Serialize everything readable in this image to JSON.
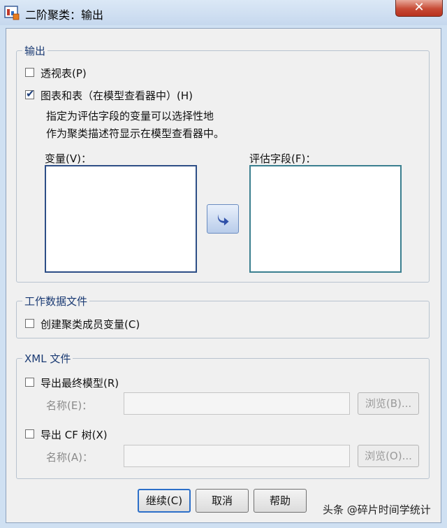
{
  "window": {
    "title": "二阶聚类：输出",
    "close_glyph": "✕"
  },
  "output_group": {
    "legend": "输出",
    "pivot_tables": {
      "label": "透视表(P)",
      "checked": false
    },
    "charts_tables": {
      "label": "图表和表（在模型查看器中）(H)",
      "checked": true
    },
    "description_line1": "指定为评估字段的变量可以选择性地",
    "description_line2": "作为聚类描述符显示在模型查看器中。",
    "variables_label": "变量(V)：",
    "evaluation_fields_label": "评估字段(F)："
  },
  "working_data_group": {
    "legend": "工作数据文件",
    "create_membership": {
      "label": "创建聚类成员变量(C)",
      "checked": false
    }
  },
  "xml_group": {
    "legend": "XML 文件",
    "export_final_model": {
      "label": "导出最终模型(R)",
      "checked": false
    },
    "final_model_name_label": "名称(E)：",
    "final_model_name_value": "",
    "browse1_label": "浏览(B)...",
    "export_cf_tree": {
      "label": "导出 CF 树(X)",
      "checked": false
    },
    "cf_tree_name_label": "名称(A)：",
    "cf_tree_name_value": "",
    "browse2_label": "浏览(O)..."
  },
  "buttons": {
    "continue": "继续(C)",
    "cancel": "取消",
    "help": "帮助"
  },
  "watermark": "头条 @碎片时间学统计",
  "colors": {
    "accent": "#2c6fc9",
    "group_title": "#1a3a73",
    "close": "#c74a35"
  }
}
